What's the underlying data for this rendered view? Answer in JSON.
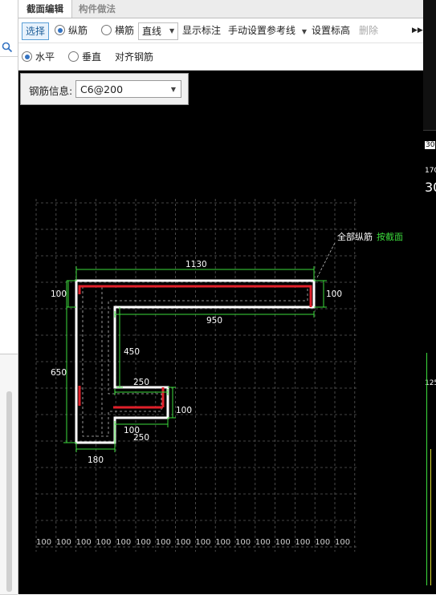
{
  "tabs": [
    {
      "label": "截面编辑",
      "active": true
    },
    {
      "label": "构件做法",
      "active": false
    }
  ],
  "toolbar1": {
    "select_label": "选择",
    "radio_longitudinal": "纵筋",
    "radio_transverse": "横筋",
    "line_mode": "直线",
    "show_annotation": "显示标注",
    "manual_ref_line": "手动设置参考线",
    "set_elevation": "设置标高",
    "delete_label": "删除",
    "more_icon": "double-chevron-right-icon"
  },
  "toolbar2": {
    "radio_horizontal": "水平",
    "radio_vertical": "垂直",
    "align_rebar": "对齐钢筋"
  },
  "rebar_info": {
    "label": "钢筋信息:",
    "value": "C6@200"
  },
  "drawing": {
    "annotation_text": "全部纵筋",
    "annotation_link": "按截面",
    "dims": {
      "top_width": "1130",
      "left_top": "100",
      "right_top": "100",
      "inner_top": "950",
      "inner_vertical": "450",
      "total_height": "650",
      "step_width": "250",
      "step_right": "100",
      "bottom_small": "100",
      "bottom_step": "250",
      "bottom_width": "180"
    },
    "grid_tick": "100",
    "grid_tick_count": 16
  },
  "right_strip_fragments": [
    "30",
    "170",
    "30",
    "125"
  ],
  "colors": {
    "background": "#000000",
    "outline": "#ffffff",
    "rebar": "#e0202a",
    "dimension": "#3cdc3c",
    "grid": "#5a5a5a",
    "accent": "#3473c2"
  }
}
